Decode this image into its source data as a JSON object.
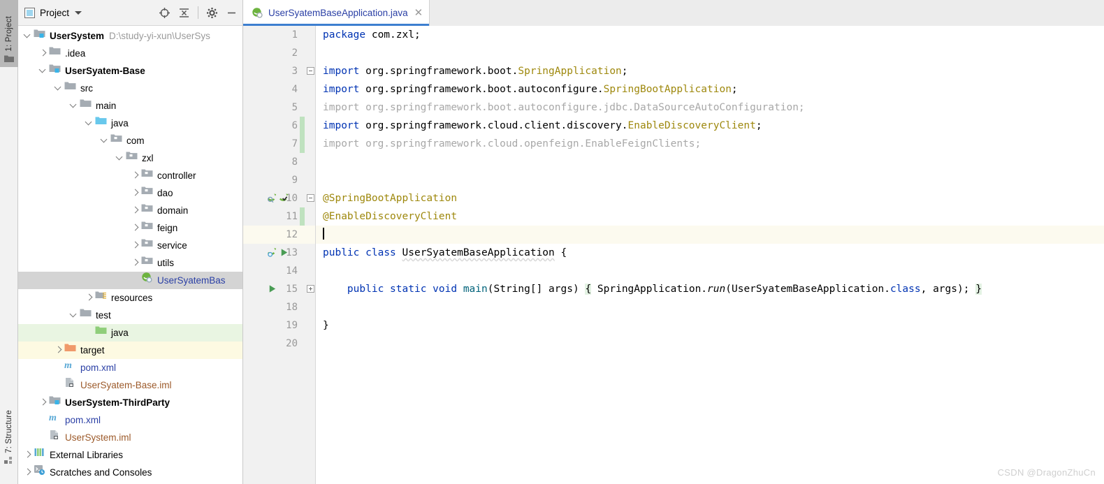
{
  "rail": {
    "project_tool": "1: Project",
    "structure_tool": "7: Structure",
    "bottom_icon": "grid-icon"
  },
  "project_panel": {
    "title": "Project",
    "title_icon": "project-view-icon",
    "dropdown_icon": "chevron-down-icon",
    "tools": [
      {
        "name": "locate-icon",
        "label": "Select Opened File"
      },
      {
        "name": "collapse-all-icon",
        "label": "Collapse All"
      },
      {
        "name": "settings-gear-icon",
        "label": "Settings"
      },
      {
        "name": "minimize-icon",
        "label": "Hide"
      }
    ],
    "tree": [
      {
        "label": "UserSystem",
        "path": "D:\\study-yi-xun\\UserSys",
        "icon": "module-folder-icon",
        "indent": 0,
        "arrow": "down",
        "bold": true,
        "state": "none"
      },
      {
        "label": ".idea",
        "icon": "folder-icon",
        "indent": 1,
        "arrow": "right",
        "bold": false,
        "state": "none"
      },
      {
        "label": "UserSyatem-Base",
        "icon": "module-folder-icon",
        "indent": 1,
        "arrow": "down",
        "bold": true,
        "state": "none"
      },
      {
        "label": "src",
        "icon": "folder-icon",
        "indent": 2,
        "arrow": "down",
        "bold": false,
        "state": "none"
      },
      {
        "label": "main",
        "icon": "folder-icon",
        "indent": 3,
        "arrow": "down",
        "bold": false,
        "state": "none"
      },
      {
        "label": "java",
        "icon": "source-root-folder-icon",
        "indent": 4,
        "arrow": "down",
        "bold": false,
        "state": "none"
      },
      {
        "label": "com",
        "icon": "package-folder-icon",
        "indent": 5,
        "arrow": "down",
        "bold": false,
        "state": "none"
      },
      {
        "label": "zxl",
        "icon": "package-folder-icon",
        "indent": 6,
        "arrow": "down",
        "bold": false,
        "state": "none"
      },
      {
        "label": "controller",
        "icon": "package-folder-icon",
        "indent": 7,
        "arrow": "right",
        "bold": false,
        "state": "none"
      },
      {
        "label": "dao",
        "icon": "package-folder-icon",
        "indent": 7,
        "arrow": "right",
        "bold": false,
        "state": "none"
      },
      {
        "label": "domain",
        "icon": "package-folder-icon",
        "indent": 7,
        "arrow": "right",
        "bold": false,
        "state": "none"
      },
      {
        "label": "feign",
        "icon": "package-folder-icon",
        "indent": 7,
        "arrow": "right",
        "bold": false,
        "state": "none"
      },
      {
        "label": "service",
        "icon": "package-folder-icon",
        "indent": 7,
        "arrow": "right",
        "bold": false,
        "state": "none"
      },
      {
        "label": "utils",
        "icon": "package-folder-icon",
        "indent": 7,
        "arrow": "right",
        "bold": false,
        "state": "none"
      },
      {
        "label": "UserSyatemBas",
        "icon": "spring-java-class-icon",
        "indent": 7,
        "arrow": "none",
        "bold": false,
        "state": "selected",
        "color": "blue"
      },
      {
        "label": "resources",
        "icon": "resources-root-folder-icon",
        "indent": 4,
        "arrow": "right",
        "bold": false,
        "state": "none"
      },
      {
        "label": "test",
        "icon": "folder-icon",
        "indent": 3,
        "arrow": "down",
        "bold": false,
        "state": "none"
      },
      {
        "label": "java",
        "icon": "test-source-root-folder-icon",
        "indent": 4,
        "arrow": "none",
        "bold": false,
        "state": "green"
      },
      {
        "label": "target",
        "icon": "excluded-folder-icon",
        "indent": 2,
        "arrow": "right",
        "bold": false,
        "state": "yellow"
      },
      {
        "label": "pom.xml",
        "icon": "maven-pom-icon",
        "indent": 2,
        "arrow": "none",
        "bold": false,
        "state": "none",
        "color": "blue"
      },
      {
        "label": "UserSyatem-Base.iml",
        "icon": "iml-module-file-icon",
        "indent": 2,
        "arrow": "none",
        "bold": false,
        "state": "none",
        "color": "brown"
      },
      {
        "label": "UserSystem-ThirdParty",
        "icon": "module-folder-icon",
        "indent": 1,
        "arrow": "right",
        "bold": true,
        "state": "none"
      },
      {
        "label": "pom.xml",
        "icon": "maven-pom-icon",
        "indent": 1,
        "arrow": "none",
        "bold": false,
        "state": "none",
        "color": "blue"
      },
      {
        "label": "UserSystem.iml",
        "icon": "iml-module-file-icon",
        "indent": 1,
        "arrow": "none",
        "bold": false,
        "state": "none",
        "color": "brown"
      },
      {
        "label": "External Libraries",
        "icon": "external-libraries-icon",
        "indent": 0,
        "arrow": "right",
        "bold": false,
        "state": "none"
      },
      {
        "label": "Scratches and Consoles",
        "icon": "scratches-consoles-icon",
        "indent": 0,
        "arrow": "right",
        "bold": false,
        "state": "none"
      }
    ]
  },
  "editor": {
    "tab": {
      "filename": "UserSyatemBaseApplication.java",
      "icon": "spring-java-class-icon",
      "close_icon": "close-icon",
      "active": true
    },
    "line_numbers": [
      "1",
      "2",
      "3",
      "4",
      "5",
      "6",
      "7",
      "8",
      "9",
      "10",
      "11",
      "12",
      "13",
      "14",
      "15",
      "18",
      "19",
      "20"
    ],
    "caret_line": 12,
    "gutter_marks": [
      {
        "line": 10,
        "icons": [
          "spring-bean-search-icon",
          "spring-bean-check-icon"
        ]
      },
      {
        "line": 13,
        "icons": [
          "spring-boot-icon",
          "run-arrow-icon"
        ]
      },
      {
        "line": 15,
        "icons": [
          "run-arrow-icon"
        ]
      }
    ],
    "code_lines": [
      {
        "n": "1",
        "text": "package com.zxl;"
      },
      {
        "n": "2",
        "text": ""
      },
      {
        "n": "3",
        "text": "import org.springframework.boot.SpringApplication;"
      },
      {
        "n": "4",
        "text": "import org.springframework.boot.autoconfigure.SpringBootApplication;"
      },
      {
        "n": "5",
        "text": "import org.springframework.boot.autoconfigure.jdbc.DataSourceAutoConfiguration;"
      },
      {
        "n": "6",
        "text": "import org.springframework.cloud.client.discovery.EnableDiscoveryClient;"
      },
      {
        "n": "7",
        "text": "import org.springframework.cloud.openfeign.EnableFeignClients;"
      },
      {
        "n": "8",
        "text": ""
      },
      {
        "n": "9",
        "text": ""
      },
      {
        "n": "10",
        "text": "@SpringBootApplication"
      },
      {
        "n": "11",
        "text": "@EnableDiscoveryClient"
      },
      {
        "n": "12",
        "text": ""
      },
      {
        "n": "13",
        "text": "public class UserSyatemBaseApplication {"
      },
      {
        "n": "14",
        "text": ""
      },
      {
        "n": "15",
        "text": "    public static void main(String[] args) { SpringApplication.run(UserSyatemBaseApplication.class, args); }"
      },
      {
        "n": "18",
        "text": ""
      },
      {
        "n": "19",
        "text": "}"
      },
      {
        "n": "20",
        "text": ""
      }
    ]
  },
  "watermark": "CSDN @DragonZhuCn",
  "colors": {
    "keyword": "#0033b3",
    "annotation": "#9e880d",
    "unused_import": "#a8a8a8",
    "tab_accent": "#3d7fd0",
    "change_bar": "#bfe2bf",
    "caret_line_bg": "#fcfaef",
    "selection_bg": "#d4d4d4",
    "test_root_bg": "#e9f5e2",
    "excluded_bg": "#fdfae2"
  }
}
